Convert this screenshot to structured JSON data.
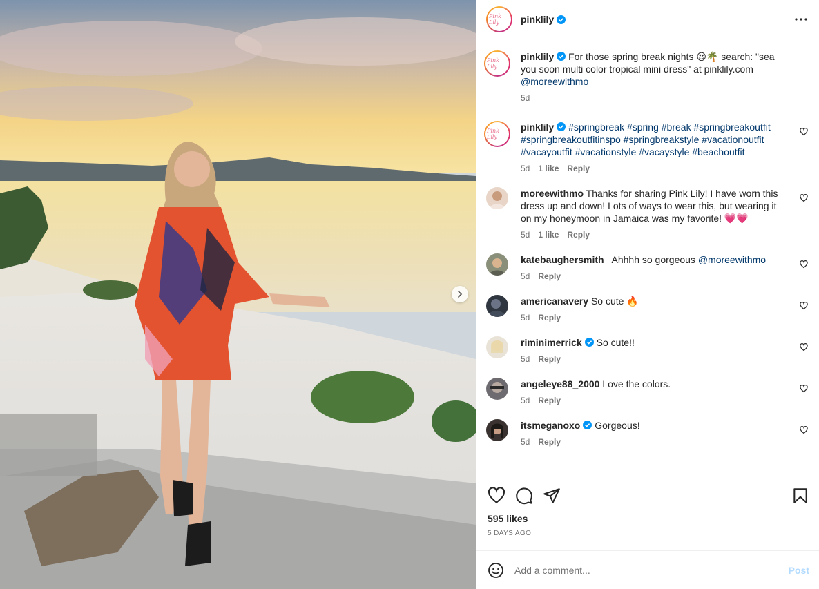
{
  "header": {
    "username": "pinklily",
    "avatar_text": "Pink Lily",
    "more_icon": "more-horizontal-icon"
  },
  "caption": {
    "username": "pinklily",
    "text": "For those spring break nights 😍🌴 search: \"sea you soon multi color tropical mini dress\" at pinklily.com",
    "mention": "@moreewithmo",
    "time": "5d"
  },
  "comments": [
    {
      "username": "pinklily",
      "verified": true,
      "hashtags": "#springbreak #spring #break #springbreakoutfit #springbreakoutfitinspo #springbreakstyle #vacationoutfit #vacayoutfit #vacationstyle #vacaystyle #beachoutfit",
      "time": "5d",
      "likes": "1 like",
      "reply": "Reply"
    },
    {
      "username": "moreewithmo",
      "text": "Thanks for sharing Pink Lily! I have worn this dress up and down! Lots of ways to wear this, but wearing it on my honeymoon in Jamaica was my favorite! 💗💗",
      "time": "5d",
      "likes": "1 like",
      "reply": "Reply"
    },
    {
      "username": "katebaughersmith_",
      "text": "Ahhhh so gorgeous",
      "mention": "@moreewithmo",
      "time": "5d",
      "reply": "Reply"
    },
    {
      "username": "americanavery",
      "text": "So cute 🔥",
      "time": "5d",
      "reply": "Reply"
    },
    {
      "username": "riminimerrick",
      "verified": true,
      "text": "So cute!!",
      "time": "5d",
      "reply": "Reply"
    },
    {
      "username": "angeleye88_2000",
      "text": "Love the colors.",
      "time": "5d",
      "reply": "Reply"
    },
    {
      "username": "itsmeganoxo",
      "verified": true,
      "text": "Gorgeous!",
      "time": "5d",
      "reply": "Reply"
    }
  ],
  "actions": {
    "like_icon": "heart-icon",
    "comment_icon": "comment-icon",
    "share_icon": "share-icon",
    "save_icon": "bookmark-icon"
  },
  "likes_text": "595 likes",
  "date_text": "5 DAYS AGO",
  "add_comment": {
    "placeholder": "Add a comment...",
    "post_label": "Post"
  },
  "colors": {
    "link": "#00376b",
    "verified": "#0095f6",
    "post_disabled": "#b3dbff",
    "muted": "#737373"
  }
}
